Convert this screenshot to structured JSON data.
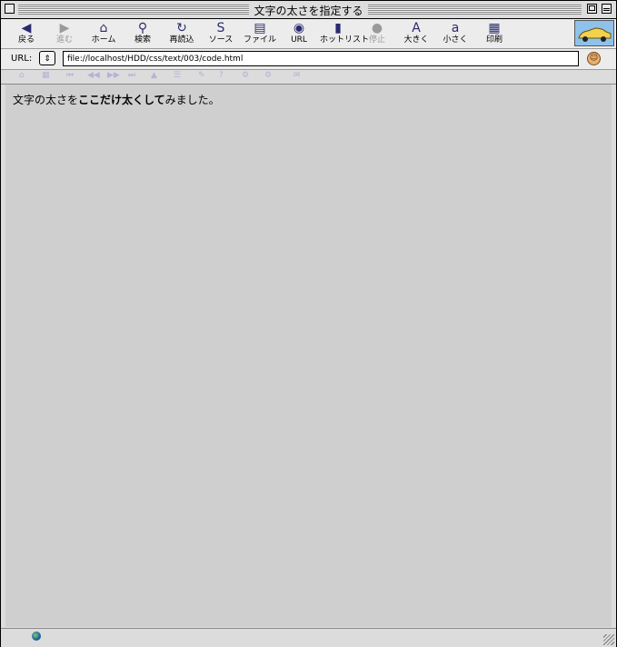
{
  "window": {
    "title": "文字の太さを指定する"
  },
  "toolbar": {
    "buttons": [
      {
        "label": "戻る",
        "icon": "◀"
      },
      {
        "label": "進む",
        "icon": "▶"
      },
      {
        "label": "ホーム",
        "icon": "⌂"
      },
      {
        "label": "検索",
        "icon": "⚲"
      },
      {
        "label": "再読込",
        "icon": "↻"
      },
      {
        "label": "ソース",
        "icon": "S"
      },
      {
        "label": "ファイル",
        "icon": "▤"
      },
      {
        "label": "URL",
        "icon": "◉"
      },
      {
        "label": "ホットリスト",
        "icon": "▮"
      },
      {
        "label": "停止",
        "icon": "●"
      },
      {
        "label": "大きく",
        "icon": "A"
      },
      {
        "label": "小さく",
        "icon": "a"
      },
      {
        "label": "印刷",
        "icon": "▦"
      }
    ]
  },
  "address": {
    "label": "URL:",
    "value": "file://localhost/HDD/css/text/003/code.html"
  },
  "content": {
    "before": "文字の太さを",
    "bold": "ここだけ太くして",
    "after": "みました。"
  }
}
